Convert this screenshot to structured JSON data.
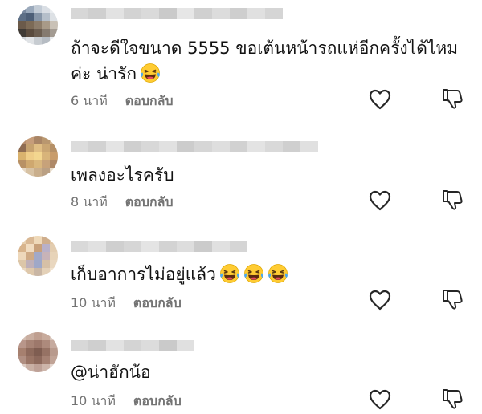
{
  "comments": [
    {
      "text": "ถ้าจะดีใจขนาด 5555 ขอเต้นหน้ารถแห่อีกครั้งได้ไหมค่ะ น่ารัก",
      "emoji_count": 1,
      "time": "6 นาที",
      "reply_label": "ตอบกลับ",
      "avatar_colors": [
        "#7a8aa0",
        "#9aa9bb",
        "#c3ccd6",
        "#d9dee4",
        "#e9ecef",
        "#5d6f86",
        "#4d5f77",
        "#8796a8",
        "#b5bfca",
        "#dde1e5",
        "#6b5a4a",
        "#7c6a56",
        "#8c7c6a",
        "#a89a88",
        "#c9c1b6",
        "#3f3a35",
        "#5a4b3e",
        "#6b5d50",
        "#857a6f",
        "#a39b92",
        "#cfd3d7",
        "#e0e3e6",
        "#c7ccd1",
        "#b6bcc3",
        "#e8eaec"
      ],
      "username_colors": [
        "#d7d7d7",
        "#cfcfcf",
        "#e2e2e2",
        "#d3d3d3",
        "#dadada",
        "#cacaca",
        "#e6e6e6",
        "#d0d0d0",
        "#dcdcdc",
        "#cecece",
        "#e0e0e0",
        "#d5d5d5"
      ]
    },
    {
      "text": "เพลงอะไรครับ",
      "emoji_count": 0,
      "time": "8 นาที",
      "reply_label": "ตอบกลับ",
      "avatar_colors": [
        "#b78e6c",
        "#c69d7a",
        "#a98566",
        "#b9976f",
        "#d3b691",
        "#8f6c52",
        "#c6a26f",
        "#e0be84",
        "#caa673",
        "#b59067",
        "#d9b26e",
        "#efcd88",
        "#f3d68f",
        "#d8b47a",
        "#c89c6b",
        "#b89165",
        "#cfa86f",
        "#d9b77d",
        "#c7a27a",
        "#ae8968",
        "#e6d7c3",
        "#d7c2a4",
        "#c9ae8c",
        "#baa084",
        "#e8dccb"
      ],
      "username_colors": [
        "#dcdcdc",
        "#d2d2d2",
        "#e4e4e4",
        "#cfcfcf",
        "#d8d8d8",
        "#e1e1e1",
        "#cccccc",
        "#d6d6d6",
        "#dedede",
        "#d1d1d1",
        "#e3e3e3",
        "#d9d9d9",
        "#cfcfcf",
        "#e0e0e0"
      ]
    },
    {
      "text": "เก็บอาการไม่อยู่แล้ว",
      "emoji_count": 3,
      "time": "10 นาที",
      "reply_label": "ตอบกลับ",
      "avatar_colors": [
        "#e7cfae",
        "#d9b894",
        "#efd9b9",
        "#cfae8c",
        "#e2c7a5",
        "#d8b48c",
        "#f1dcc0",
        "#c8a07a",
        "#b8b0c8",
        "#e3cdb0",
        "#eed8bb",
        "#cfaa85",
        "#a2a9c7",
        "#c7b3b8",
        "#e7d3b8",
        "#dcc6a8",
        "#bfb0b8",
        "#9fa8c8",
        "#d6c0a6",
        "#e9d7bf",
        "#ead8c2",
        "#dec8ab",
        "#c9b6a4",
        "#e4d1b8",
        "#f0e2cf"
      ],
      "username_colors": [
        "#d9d9d9",
        "#e1e1e1",
        "#cfcfcf",
        "#d6d6d6",
        "#e4e4e4",
        "#d3d3d3",
        "#dddddd",
        "#cbcbcb",
        "#e0e0e0",
        "#d5d5d5"
      ]
    },
    {
      "text": "@น่าฮักน้อ",
      "emoji_count": 0,
      "time": "10 นาที",
      "reply_label": "ตอบกลับ",
      "avatar_colors": [
        "#d2bcb0",
        "#c9aea0",
        "#bf9f90",
        "#c8ab9c",
        "#d8c5bb",
        "#b8968a",
        "#a78375",
        "#9d786b",
        "#ad8a7c",
        "#c6ab9f",
        "#a6806f",
        "#8e6a5c",
        "#7f5d51",
        "#967264",
        "#b89a8d",
        "#b08f82",
        "#9a7566",
        "#8d695c",
        "#a58173",
        "#c0a396",
        "#dccbc2",
        "#c9b0a5",
        "#bea197",
        "#cdb5aa",
        "#e3d5ce"
      ],
      "username_colors": [
        "#d8d8d8",
        "#cfcfcf",
        "#e2e2e2",
        "#d4d4d4",
        "#dcdcdc",
        "#cacaca",
        "#e0e0e0"
      ]
    }
  ],
  "icons": {
    "like": "heart-outline-icon",
    "dislike": "thumbs-down-outline-icon",
    "emoji": "face-with-tears-of-joy-icon"
  },
  "colors": {
    "text": "#121212",
    "meta": "#737373",
    "icon": "#262626"
  }
}
